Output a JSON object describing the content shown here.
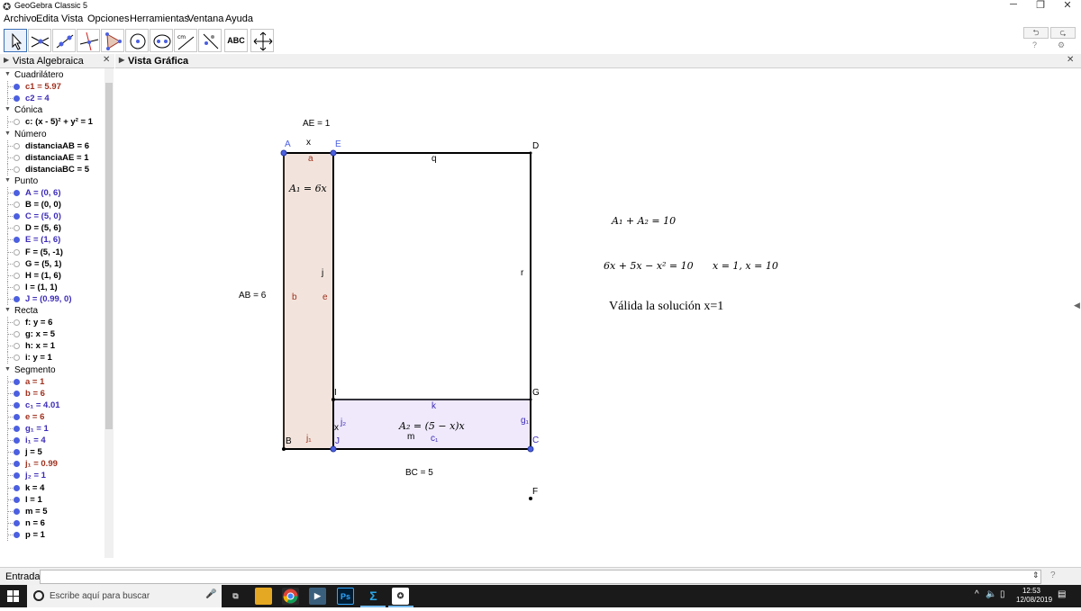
{
  "window": {
    "title": "GeoGebra Classic 5",
    "minimize": "─",
    "restore": "❐",
    "close": "✕"
  },
  "menu": [
    "Archivo",
    "Edita",
    "Vista",
    "Opciones",
    "Herramientas",
    "Ventana",
    "Ayuda"
  ],
  "toolbar": {
    "text_tool": "ABC",
    "undo": "⮌",
    "redo": "⮎"
  },
  "algebra_view": {
    "title": "Vista Algebraica",
    "rows": [
      {
        "kind": "cat",
        "label": "Cuadrilátero"
      },
      {
        "kind": "item",
        "text": "c1 = 5.97",
        "color": "#a0301e",
        "dot": "filled"
      },
      {
        "kind": "item",
        "text": "c2 = 4",
        "color": "#3b2bb8",
        "dot": "filled"
      },
      {
        "kind": "cat",
        "label": "Cónica"
      },
      {
        "kind": "item",
        "text": "c: (x - 5)² + y² = 1",
        "color": "#000000",
        "dot": "empty"
      },
      {
        "kind": "cat",
        "label": "Número"
      },
      {
        "kind": "item",
        "text": "distanciaAB = 6",
        "color": "#000000",
        "dot": "empty"
      },
      {
        "kind": "item",
        "text": "distanciaAE = 1",
        "color": "#000000",
        "dot": "empty"
      },
      {
        "kind": "item",
        "text": "distanciaBC = 5",
        "color": "#000000",
        "dot": "empty"
      },
      {
        "kind": "cat",
        "label": "Punto"
      },
      {
        "kind": "item",
        "text": "A = (0, 6)",
        "color": "#3b2bb8",
        "dot": "filled"
      },
      {
        "kind": "item",
        "text": "B = (0, 0)",
        "color": "#000000",
        "dot": "empty"
      },
      {
        "kind": "item",
        "text": "C = (5, 0)",
        "color": "#3b2bb8",
        "dot": "filled"
      },
      {
        "kind": "item",
        "text": "D = (5, 6)",
        "color": "#000000",
        "dot": "empty"
      },
      {
        "kind": "item",
        "text": "E = (1, 6)",
        "color": "#3b2bb8",
        "dot": "filled"
      },
      {
        "kind": "item",
        "text": "F = (5, -1)",
        "color": "#000000",
        "dot": "empty"
      },
      {
        "kind": "item",
        "text": "G = (5, 1)",
        "color": "#000000",
        "dot": "empty"
      },
      {
        "kind": "item",
        "text": "H = (1, 6)",
        "color": "#000000",
        "dot": "empty"
      },
      {
        "kind": "item",
        "text": "I = (1, 1)",
        "color": "#000000",
        "dot": "empty"
      },
      {
        "kind": "item",
        "text": "J = (0.99, 0)",
        "color": "#3b2bb8",
        "dot": "filled"
      },
      {
        "kind": "cat",
        "label": "Recta"
      },
      {
        "kind": "item",
        "text": "f: y = 6",
        "color": "#000000",
        "dot": "empty"
      },
      {
        "kind": "item",
        "text": "g: x = 5",
        "color": "#000000",
        "dot": "empty"
      },
      {
        "kind": "item",
        "text": "h: x = 1",
        "color": "#000000",
        "dot": "empty"
      },
      {
        "kind": "item",
        "text": "i: y = 1",
        "color": "#000000",
        "dot": "empty"
      },
      {
        "kind": "cat",
        "label": "Segmento"
      },
      {
        "kind": "item",
        "text": "a = 1",
        "color": "#a0301e",
        "dot": "filled"
      },
      {
        "kind": "item",
        "text": "b = 6",
        "color": "#a0301e",
        "dot": "filled"
      },
      {
        "kind": "item",
        "text": "c₁ = 4.01",
        "color": "#3b2bb8",
        "dot": "filled"
      },
      {
        "kind": "item",
        "text": "e = 6",
        "color": "#a0301e",
        "dot": "filled"
      },
      {
        "kind": "item",
        "text": "g₁ = 1",
        "color": "#3b2bb8",
        "dot": "filled"
      },
      {
        "kind": "item",
        "text": "i₁ = 4",
        "color": "#3b2bb8",
        "dot": "filled"
      },
      {
        "kind": "item",
        "text": "j = 5",
        "color": "#000000",
        "dot": "filled"
      },
      {
        "kind": "item",
        "text": "j₁ = 0.99",
        "color": "#a0301e",
        "dot": "filled"
      },
      {
        "kind": "item",
        "text": "j₂ = 1",
        "color": "#3b2bb8",
        "dot": "filled"
      },
      {
        "kind": "item",
        "text": "k = 4",
        "color": "#000000",
        "dot": "filled"
      },
      {
        "kind": "item",
        "text": "l = 1",
        "color": "#000000",
        "dot": "filled"
      },
      {
        "kind": "item",
        "text": "m = 5",
        "color": "#000000",
        "dot": "filled"
      },
      {
        "kind": "item",
        "text": "n = 6",
        "color": "#000000",
        "dot": "filled"
      },
      {
        "kind": "item",
        "text": "p = 1",
        "color": "#000000",
        "dot": "filled"
      }
    ]
  },
  "graphics_view": {
    "title": "Vista Gráfica",
    "labels": {
      "AE": "AE = 1",
      "AB": "AB = 6",
      "BC": "BC = 5",
      "x_top": "x",
      "x_side": "x",
      "A": "A",
      "B": "B",
      "C": "C",
      "D": "D",
      "E": "E",
      "F": "F",
      "G": "G",
      "I": "I",
      "J": "J",
      "a": "a",
      "b": "b",
      "e": "e",
      "j": "j",
      "q": "q",
      "r": "r",
      "k": "k",
      "m": "m",
      "c1": "c₁",
      "j1": "j₁",
      "j2": "j₂",
      "g1": "g₁"
    },
    "formulas": {
      "A1": "A₁ = 6x",
      "A2": "A₂ = (5 − x)x",
      "sum": "A₁ + A₂ = 10",
      "eq": "6x + 5x − x² = 10",
      "sol": "x = 1, x = 10",
      "valid": "Válida la solución  x=1"
    }
  },
  "input_bar": {
    "label": "Entrada:",
    "value": "",
    "help": "?"
  },
  "taskbar": {
    "search_placeholder": "Escribe aquí para buscar",
    "time": "12:53",
    "date": "12/08/2019",
    "ps": "Ps"
  }
}
